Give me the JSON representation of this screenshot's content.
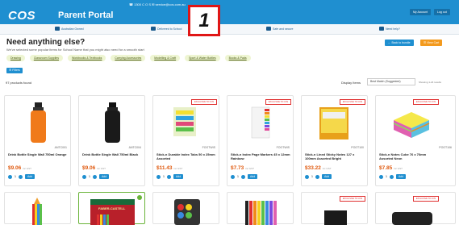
{
  "header": {
    "logo": "COS",
    "title": "Parent Portal",
    "contact": "☎ 1300 C O S   ✉ service@cos.com.au",
    "buttons": [
      "My Account",
      "Log out"
    ]
  },
  "nav": [
    "Australian Owned",
    "Delivered to School",
    "Safe and secure",
    "Need help?"
  ],
  "badge": "1",
  "page": {
    "heading": "Need anything else?",
    "subtext": "We've selected some popular items for School Name that you might also need for a smooth start",
    "back_button": "← Back to bundle",
    "cart_button": "☰ View Cart",
    "chips": [
      "Drawing",
      "Classroom Supplies",
      "Workbooks & Textbooks",
      "Carrying Accessories",
      "Modelling & Craft",
      "Sport & Water Bottles",
      "Books & Pads"
    ],
    "filter_button": "☰ Filters",
    "found": "97 products found",
    "sort_label": "Display Items",
    "sort_value": "Best Match (Suggested)",
    "sort_note": "Showing 1-24 results"
  },
  "exclusive_label": "EXCLUSIVE TO COS",
  "products": [
    {
      "code": "ANTC001",
      "name": "Drink Bottle Single Wall 750ml Orange",
      "price": "$9.06",
      "unit": "inc GST",
      "add": "Add",
      "exclusive": false
    },
    {
      "code": "ANTC004",
      "name": "Drink Bottle Single Wall 750ml Black",
      "price": "$9.06",
      "unit": "inc GST",
      "add": "Add",
      "exclusive": false
    },
    {
      "code": "FOOTWIS",
      "name": "Stick-n Durable Index Tabs 50 x 25mm Assorted",
      "price": "$11.43",
      "unit": "inc GST",
      "add": "Add",
      "exclusive": true
    },
    {
      "code": "FOOTWIS",
      "name": "Stick-n Index Page Markers 45 x 12mm Rainbow",
      "price": "$7.73",
      "unit": "inc GST",
      "add": "Add",
      "exclusive": true
    },
    {
      "code": "POOT100",
      "name": "Stick-n Lined Sticky Notes 127 x 100mm Assorted Bright",
      "price": "$33.22",
      "unit": "inc GST",
      "add": "Add",
      "exclusive": true
    },
    {
      "code": "POOT106",
      "name": "Stick-n Notes Cube 76 x 76mm Assorted Neon",
      "price": "$7.85",
      "unit": "inc GST",
      "add": "Add",
      "exclusive": true
    }
  ],
  "second_row": {
    "faber": "FABER-CASTELL"
  }
}
